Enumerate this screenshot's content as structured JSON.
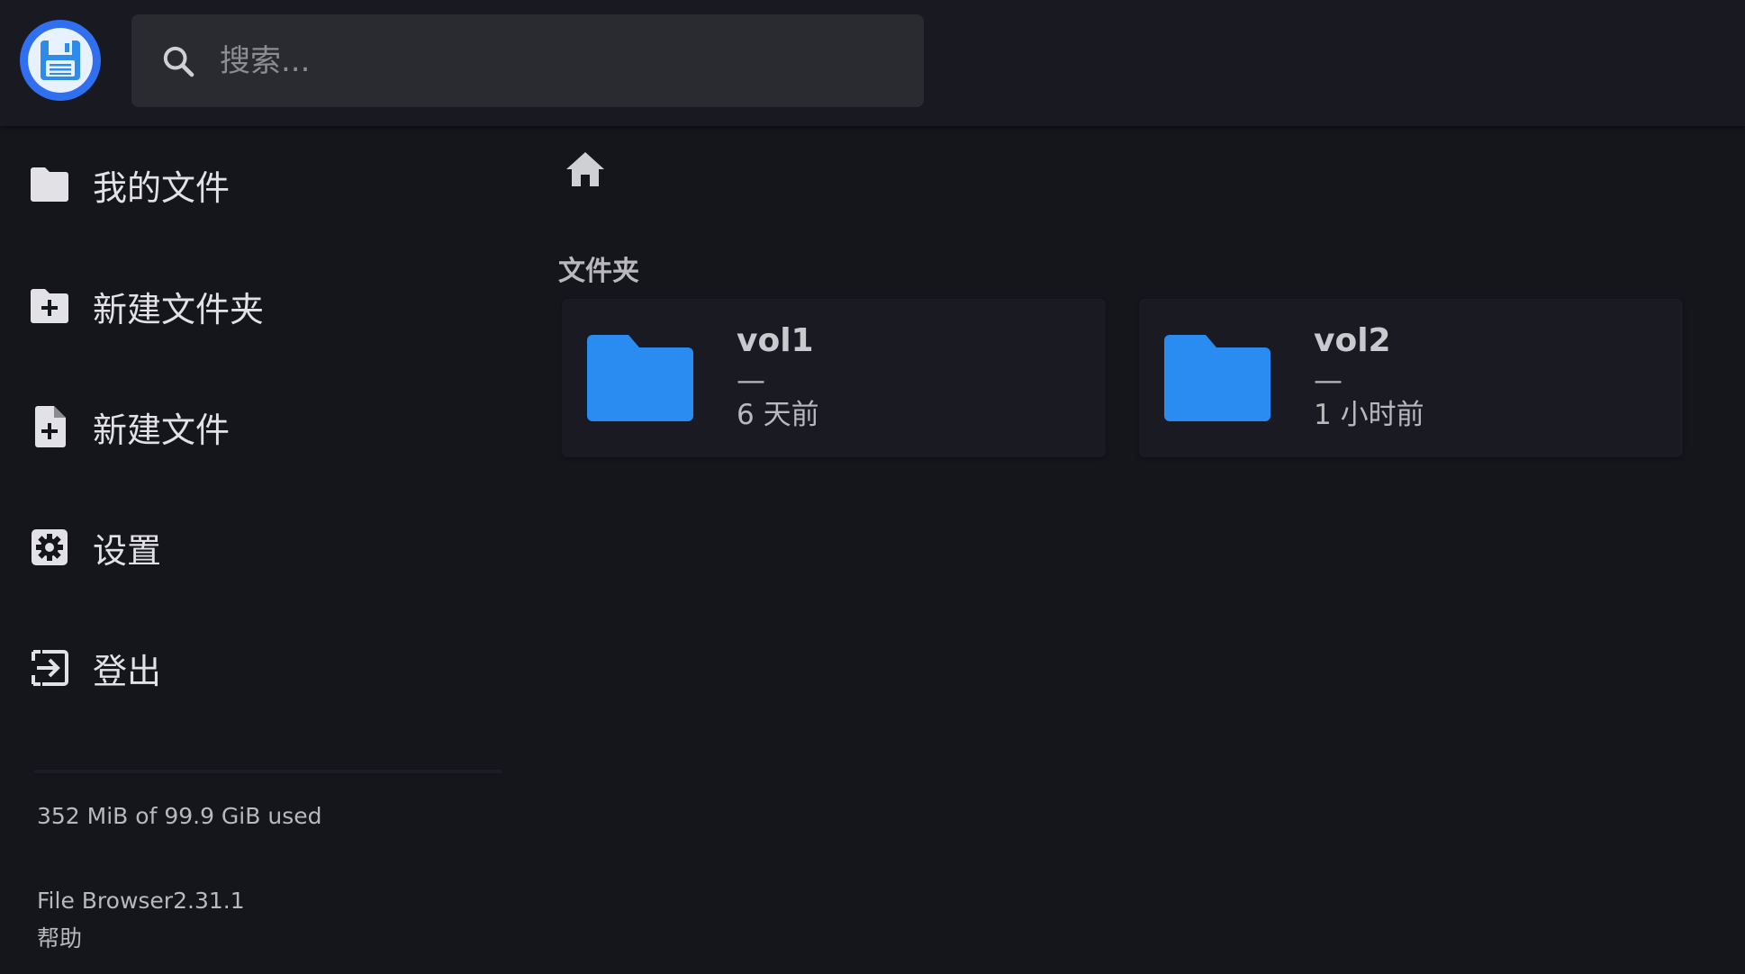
{
  "header": {
    "search_placeholder": "搜索..."
  },
  "sidebar": {
    "items": [
      {
        "label": "我的文件",
        "icon": "folder-icon"
      },
      {
        "label": "新建文件夹",
        "icon": "create-folder-icon"
      },
      {
        "label": "新建文件",
        "icon": "new-file-icon"
      },
      {
        "label": "设置",
        "icon": "settings-icon"
      },
      {
        "label": "登出",
        "icon": "logout-icon"
      }
    ],
    "usage": "352 MiB of 99.9 GiB used",
    "version": "File Browser2.31.1",
    "help": "帮助"
  },
  "main": {
    "section_title": "文件夹",
    "folders": [
      {
        "name": "vol1",
        "size": "—",
        "modified": "6 天前"
      },
      {
        "name": "vol2",
        "size": "—",
        "modified": "1 小时前"
      }
    ]
  },
  "colors": {
    "accent": "#2f6ff0",
    "folder": "#2a8cf0",
    "background": "#15161c",
    "header": "#191a21",
    "search_bg": "#2a2b31",
    "card_bg": "#1a1b22"
  }
}
